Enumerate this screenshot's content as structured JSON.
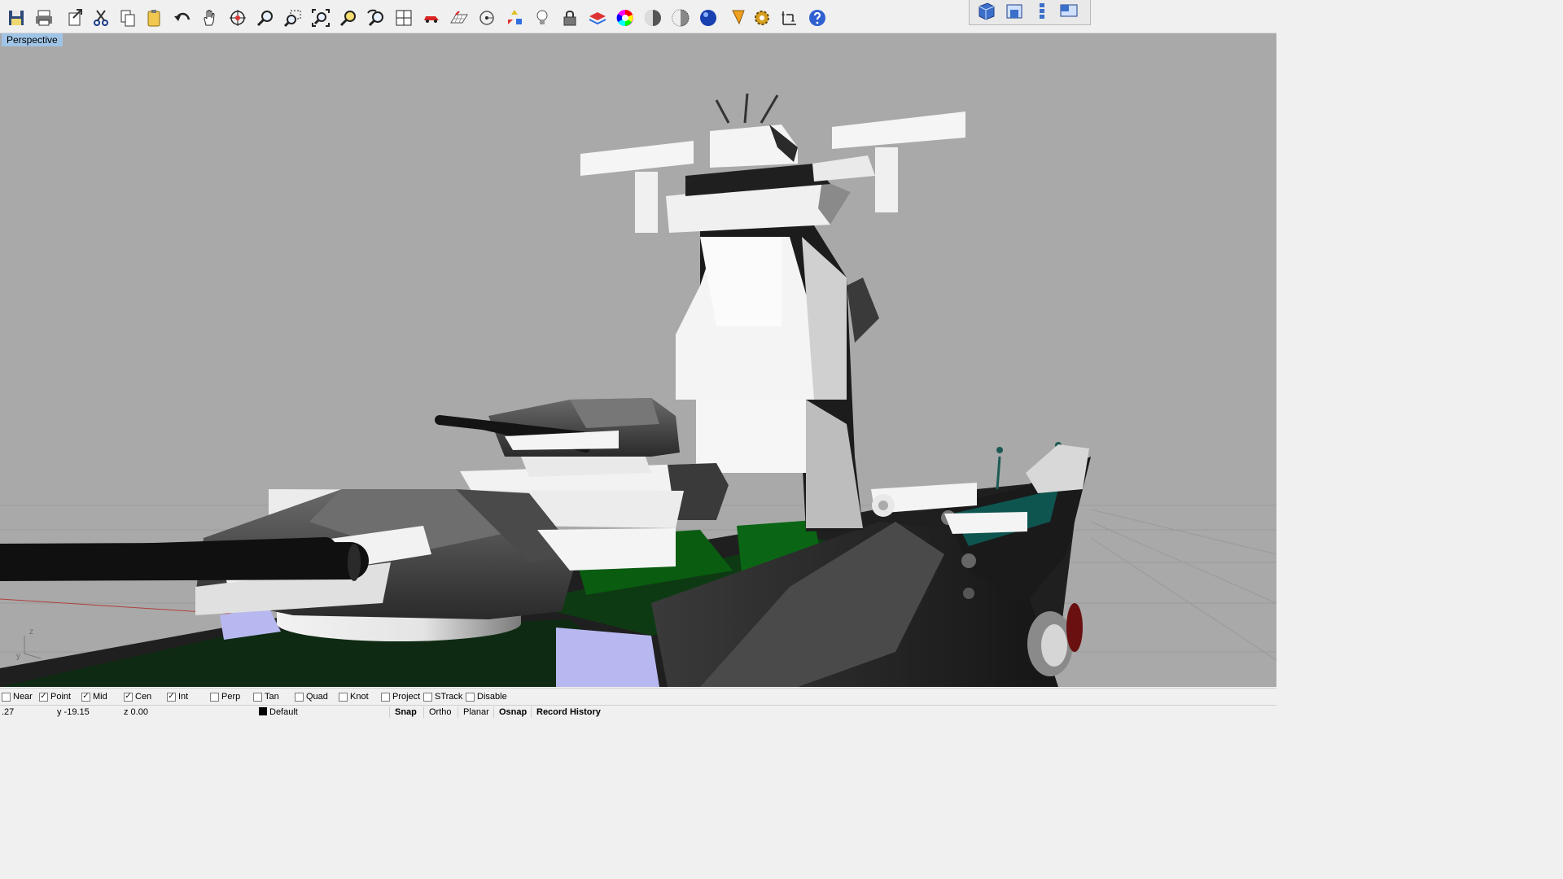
{
  "toolbar": {
    "buttons": [
      {
        "name": "save-icon"
      },
      {
        "name": "print-icon"
      },
      {
        "name": "export-icon"
      },
      {
        "name": "cut-icon"
      },
      {
        "name": "copy-icon"
      },
      {
        "name": "paste-icon"
      },
      {
        "name": "undo-icon"
      },
      {
        "name": "pan-hand-icon"
      },
      {
        "name": "rotate-view-icon"
      },
      {
        "name": "zoom-dynamic-icon"
      },
      {
        "name": "zoom-window-icon"
      },
      {
        "name": "zoom-extents-icon"
      },
      {
        "name": "zoom-selected-icon"
      },
      {
        "name": "undo-view-icon"
      },
      {
        "name": "four-viewports-icon"
      },
      {
        "name": "car-icon"
      },
      {
        "name": "grid-icon"
      },
      {
        "name": "point-icon"
      },
      {
        "name": "gumball-icon"
      },
      {
        "name": "light-bulb-icon"
      },
      {
        "name": "lock-icon"
      },
      {
        "name": "layer-icon"
      },
      {
        "name": "color-wheel-icon"
      },
      {
        "name": "shaded-sphere-icon"
      },
      {
        "name": "rendered-sphere-icon"
      },
      {
        "name": "render-icon"
      },
      {
        "name": "tag-icon"
      },
      {
        "name": "options-gear-icon"
      },
      {
        "name": "dimension-icon"
      },
      {
        "name": "help-icon"
      }
    ],
    "view_buttons": [
      {
        "name": "view-perspective-icon"
      },
      {
        "name": "view-top-icon"
      },
      {
        "name": "view-front-icon"
      },
      {
        "name": "view-right-icon"
      }
    ]
  },
  "viewport": {
    "label": "Perspective",
    "background": "#a9a9a9",
    "axis_label_z": "z",
    "axis_label_y": "y"
  },
  "osnap": {
    "items": [
      {
        "label": "Near",
        "checked": false
      },
      {
        "label": "Point",
        "checked": true
      },
      {
        "label": "Mid",
        "checked": true
      },
      {
        "label": "Cen",
        "checked": true
      },
      {
        "label": "Int",
        "checked": true
      },
      {
        "label": "Perp",
        "checked": false
      },
      {
        "label": "Tan",
        "checked": false
      },
      {
        "label": "Quad",
        "checked": false
      },
      {
        "label": "Knot",
        "checked": false
      },
      {
        "label": "Project",
        "checked": false
      },
      {
        "label": "STrack",
        "checked": false
      },
      {
        "label": "Disable",
        "checked": false
      }
    ]
  },
  "status": {
    "x": ".27",
    "y": "y -19.15",
    "z": "z 0.00",
    "layer": "Default",
    "panes": [
      {
        "label": "Snap",
        "active": true
      },
      {
        "label": "Ortho",
        "active": false
      },
      {
        "label": "Planar",
        "active": false
      },
      {
        "label": "Osnap",
        "active": true
      },
      {
        "label": "Record History",
        "active": true
      }
    ]
  }
}
